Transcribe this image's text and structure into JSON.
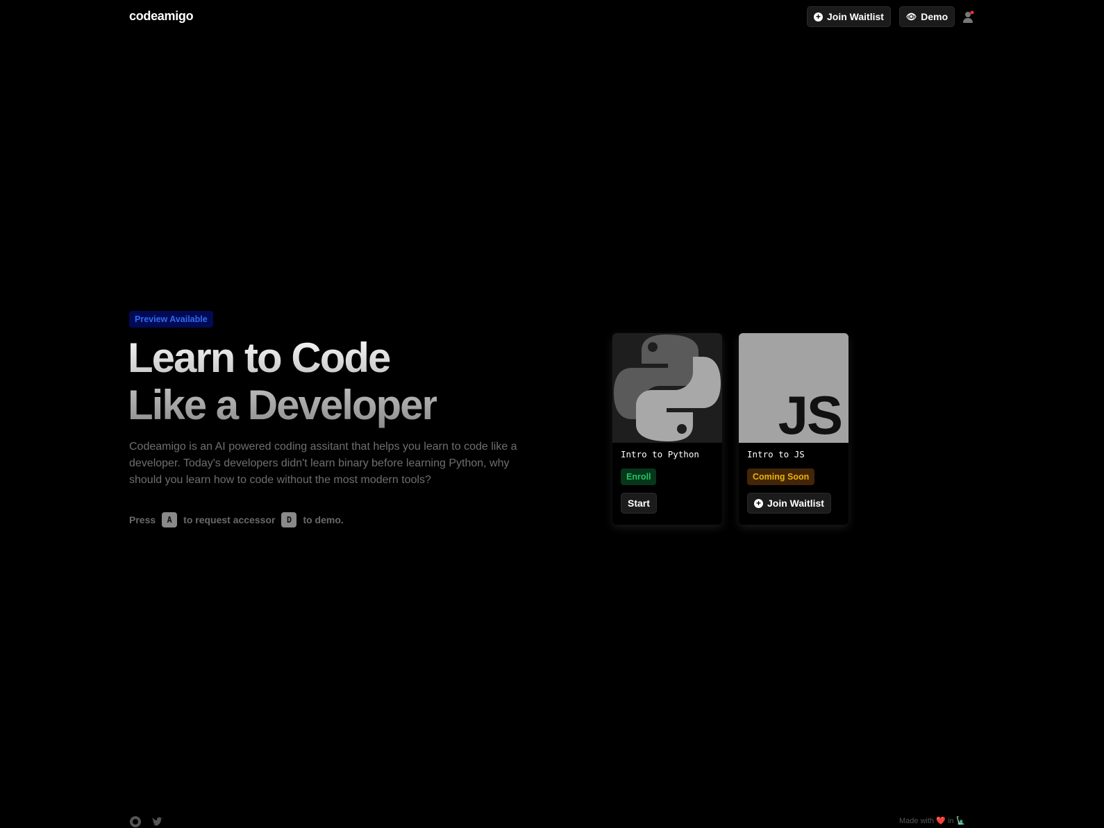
{
  "nav": {
    "logo": "codeamigo",
    "join_waitlist": "Join Waitlist",
    "demo": "Demo"
  },
  "hero": {
    "badge": "Preview Available",
    "title_line1": "Learn to Code",
    "title_line2": "Like a Developer",
    "description": "Codeamigo is an AI powered coding assitant that helps you learn to code like a developer. Today's developers didn't learn binary before learning Python, why should you learn how to code without the most modern tools?",
    "press": "Press",
    "key_a": "A",
    "request": "to request accessor",
    "key_d": "D",
    "demo": "to demo."
  },
  "cards": [
    {
      "title": "Intro to Python",
      "tag": "Enroll",
      "button": "Start"
    },
    {
      "title": "Intro to JS",
      "logo_text": "JS",
      "tag": "Coming Soon",
      "button": "Join Waitlist"
    }
  ],
  "footer": {
    "made_with": "Made with ❤️ in 🗽"
  }
}
